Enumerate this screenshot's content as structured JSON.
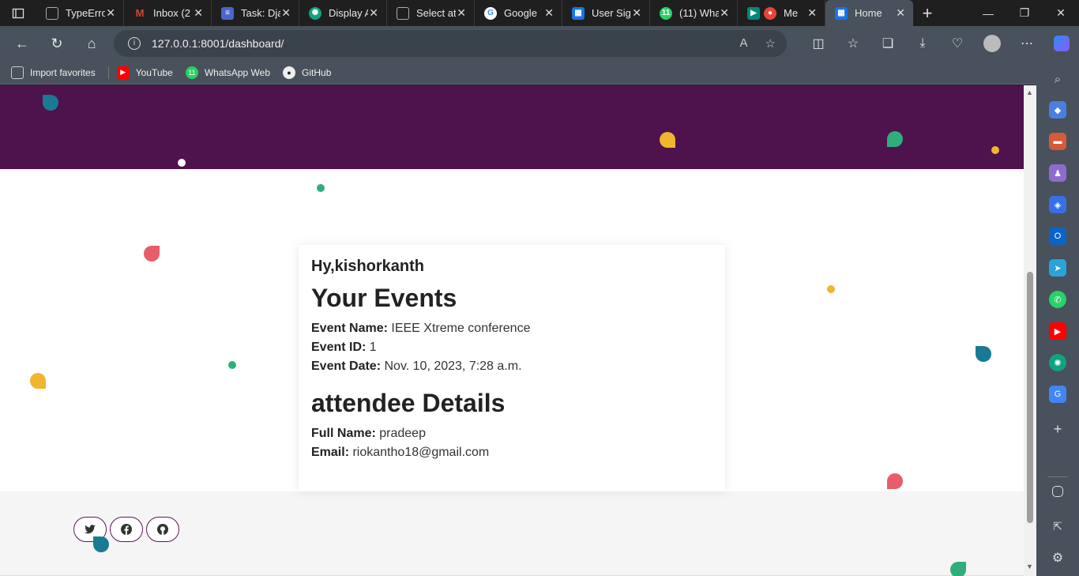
{
  "browser": {
    "tabs": [
      {
        "title": "TypeError",
        "color": "#3a3a3a",
        "glyph": "▢"
      },
      {
        "title": "Inbox (2",
        "color": "#d44638",
        "glyph": "M"
      },
      {
        "title": "Task: Dja",
        "color": "#4a66c9",
        "glyph": "≡"
      },
      {
        "title": "Display A",
        "color": "#10a37f",
        "glyph": "✺"
      },
      {
        "title": "Select at",
        "color": "#3a3a3a",
        "glyph": "▢"
      },
      {
        "title": "Google",
        "color": "#ffffff",
        "glyph": "G"
      },
      {
        "title": "User Sig",
        "color": "#1a73e8",
        "glyph": "▦"
      },
      {
        "title": "(11) Wha",
        "color": "#25d366",
        "glyph": "11"
      },
      {
        "title": "Me",
        "color": "#ea4335",
        "glyph": "◉"
      },
      {
        "title": "Home",
        "color": "#1a73e8",
        "glyph": "▦",
        "active": true
      }
    ],
    "url": "127.0.0.1:8001/dashboard/",
    "bookmarks": [
      "Import favorites",
      "YouTube",
      "WhatsApp Web",
      "GitHub"
    ]
  },
  "page": {
    "greeting": "Hy,kishorkanth",
    "events_heading": "Your Events",
    "event": {
      "name_label": "Event Name:",
      "name": "IEEE Xtreme conference",
      "id_label": "Event ID:",
      "id": "1",
      "date_label": "Event Date:",
      "date": "Nov. 10, 2023, 7:28 a.m."
    },
    "attendee_heading": "attendee Details",
    "attendee": {
      "name_label": "Full Name:",
      "name": "pradeep",
      "email_label": "Email:",
      "email": "riokantho18@gmail.com"
    },
    "social": [
      "twitter-icon",
      "facebook-icon",
      "github-icon"
    ],
    "colors": {
      "hero": "#4e134c",
      "accent_border": "#5b1757"
    }
  }
}
